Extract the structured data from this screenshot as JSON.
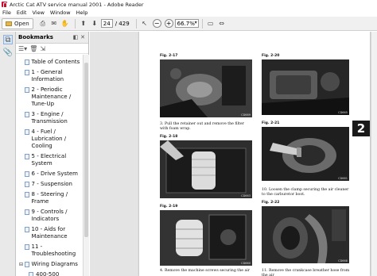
{
  "window": {
    "title": "Arctic Cat ATV service manual 2001 - Adobe Reader"
  },
  "menu": [
    "File",
    "Edit",
    "View",
    "Window",
    "Help"
  ],
  "toolbar": {
    "open_label": "Open",
    "page_current": "24",
    "page_total": "/ 429",
    "zoom": "66.7%"
  },
  "bookmarks": {
    "title": "Bookmarks",
    "items": [
      {
        "label": "Table of Contents",
        "expand": ""
      },
      {
        "label": "1 - General Information",
        "expand": ""
      },
      {
        "label": "2 - Periodic Maintenance / Tune-Up",
        "expand": ""
      },
      {
        "label": "3 - Engine / Transmission",
        "expand": ""
      },
      {
        "label": "4 - Fuel / Lubrication / Cooling",
        "expand": ""
      },
      {
        "label": "5 - Electrical System",
        "expand": ""
      },
      {
        "label": "6 - Drive System",
        "expand": ""
      },
      {
        "label": "7 - Suspension",
        "expand": ""
      },
      {
        "label": "8 - Steering / Frame",
        "expand": ""
      },
      {
        "label": "9 - Controls / Indicators",
        "expand": ""
      },
      {
        "label": "10 - Aids for Maintenance",
        "expand": ""
      },
      {
        "label": "11 - Troubleshooting",
        "expand": ""
      },
      {
        "label": "Wiring Diagrams",
        "expand": "⊟"
      },
      {
        "label": "400-500",
        "expand": ""
      }
    ]
  },
  "document": {
    "section_number": "2",
    "figures": [
      {
        "label": "Fig. 2-17",
        "code": "CD669"
      },
      {
        "label": "Fig. 2-18",
        "code": "CD663"
      },
      {
        "label": "Fig. 2-19",
        "code": "CD660"
      },
      {
        "label": "Fig. 2-20",
        "code": "CD665"
      },
      {
        "label": "Fig. 2-21",
        "code": "CD681"
      },
      {
        "label": "Fig. 2-22",
        "code": "CD668"
      }
    ],
    "captions": [
      "3.  Pull the retainer out and remove the filter with foam wrap.",
      "10.  Loosen the clamp securing the air cleaner to the carburetor boot.",
      "4.  Remove the machine screws securing the air",
      "11.  Remove the crankcase breather hose from the air"
    ]
  }
}
